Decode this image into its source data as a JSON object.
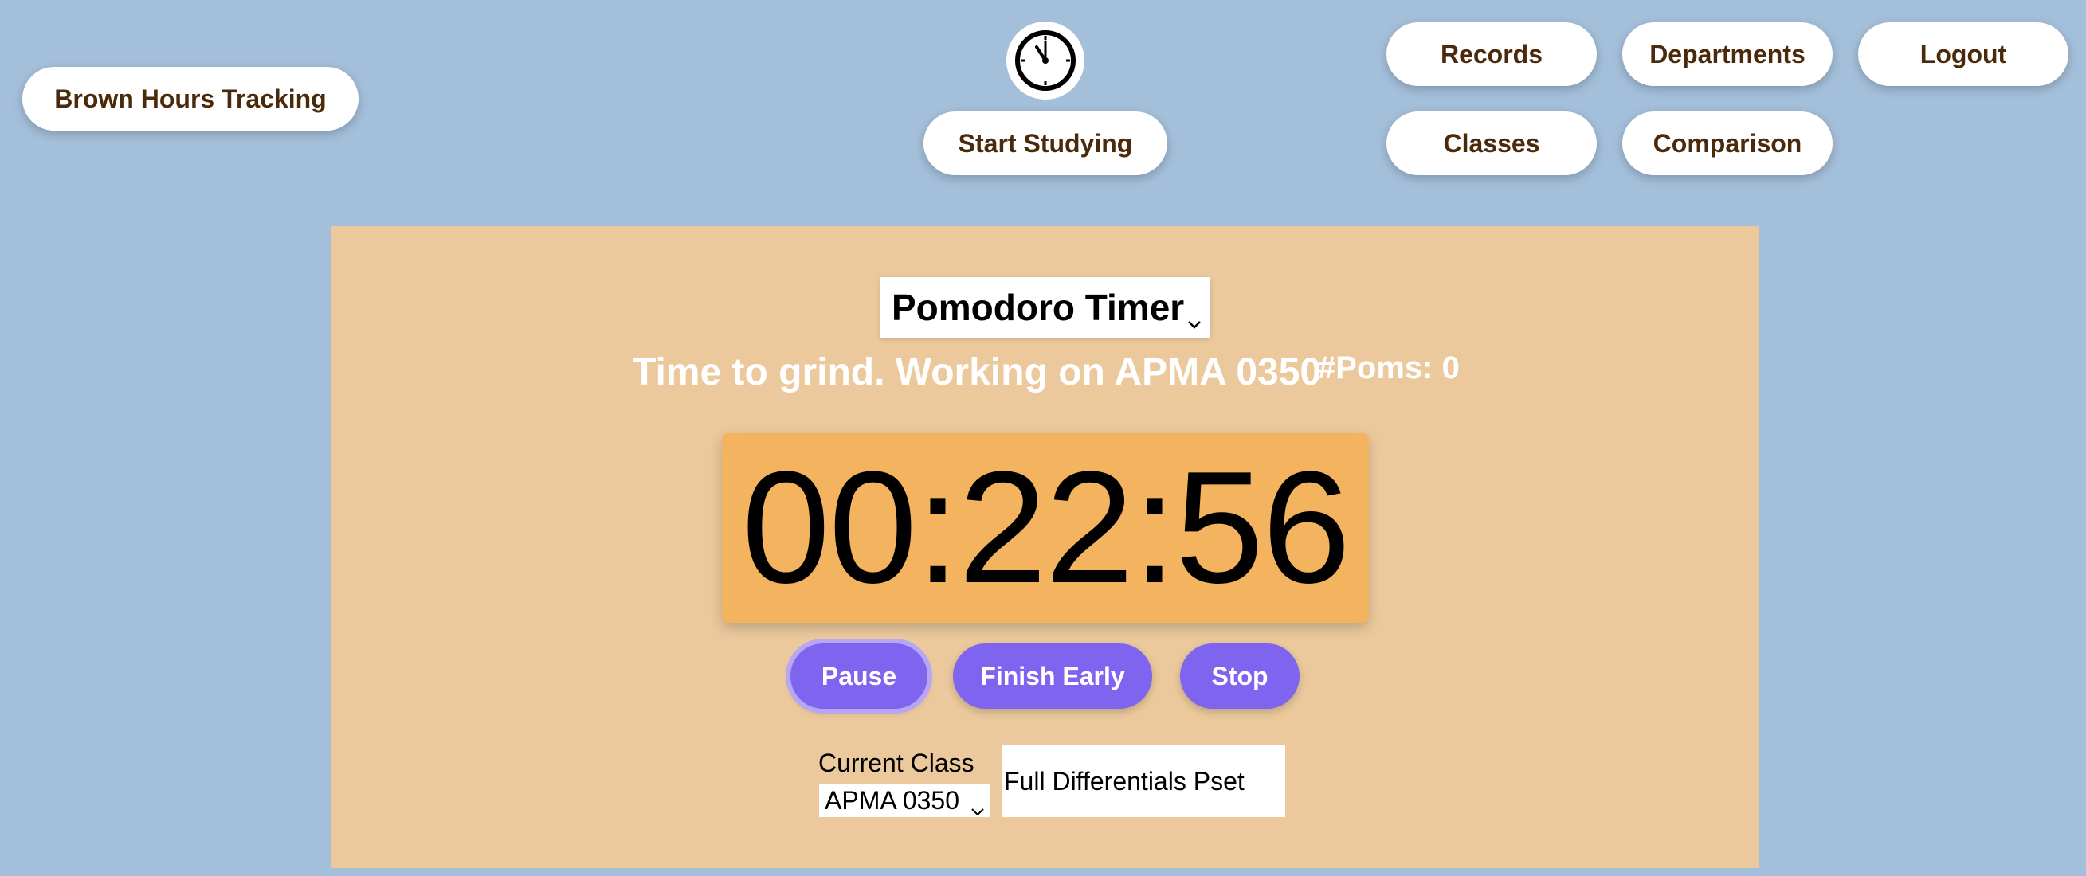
{
  "nav": {
    "brand_label": "Brown Hours Tracking",
    "start_studying_label": "Start Studying",
    "records_label": "Records",
    "departments_label": "Departments",
    "logout_label": "Logout",
    "classes_label": "Classes",
    "comparison_label": "Comparison",
    "logo_icon": "clock-icon"
  },
  "timer": {
    "mode_selected": "Pomodoro Timer",
    "status_message": "Time to grind. Working on APMA 0350",
    "poms_label": "#Poms: 0",
    "time_display": "00:22:56"
  },
  "controls": {
    "pause_label": "Pause",
    "finish_early_label": "Finish Early",
    "stop_label": "Stop"
  },
  "class_picker": {
    "label": "Current Class",
    "selected": "APMA 0350"
  },
  "task": {
    "value": "Full Differentials Pset"
  },
  "colors": {
    "background": "#a4bfda",
    "panel": "#ebc99c",
    "timer_box": "#f4b35e",
    "action_button": "#7e64ef",
    "nav_text": "#4a2a0a"
  }
}
